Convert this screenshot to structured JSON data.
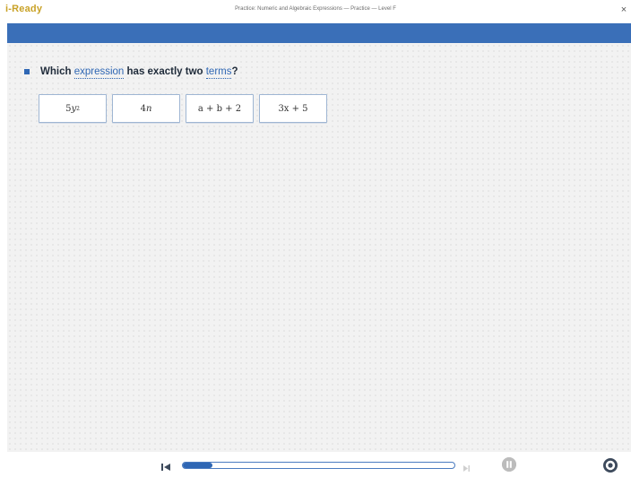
{
  "titlebar": {
    "logo_text": "i-Ready",
    "window_title": "Practice: Numeric and Algebraic Expressions — Practice — Level F",
    "close_label": "×"
  },
  "question": {
    "prefix": "Which ",
    "link1": "expression",
    "middle": " has exactly two ",
    "link2": "terms",
    "suffix": "?"
  },
  "choices": [
    {
      "coef": "5",
      "var": "y",
      "exp": "2"
    },
    {
      "coef": "4",
      "var": "n"
    },
    {
      "text": "a + b + 2"
    },
    {
      "text": "3x + 5"
    }
  ],
  "controls": {
    "progress_fraction": 0.11,
    "icons": [
      "skip-back-icon",
      "skip-forward-icon",
      "pause-icon",
      "settings-icon"
    ],
    "accent_color": "#2f67b4"
  }
}
